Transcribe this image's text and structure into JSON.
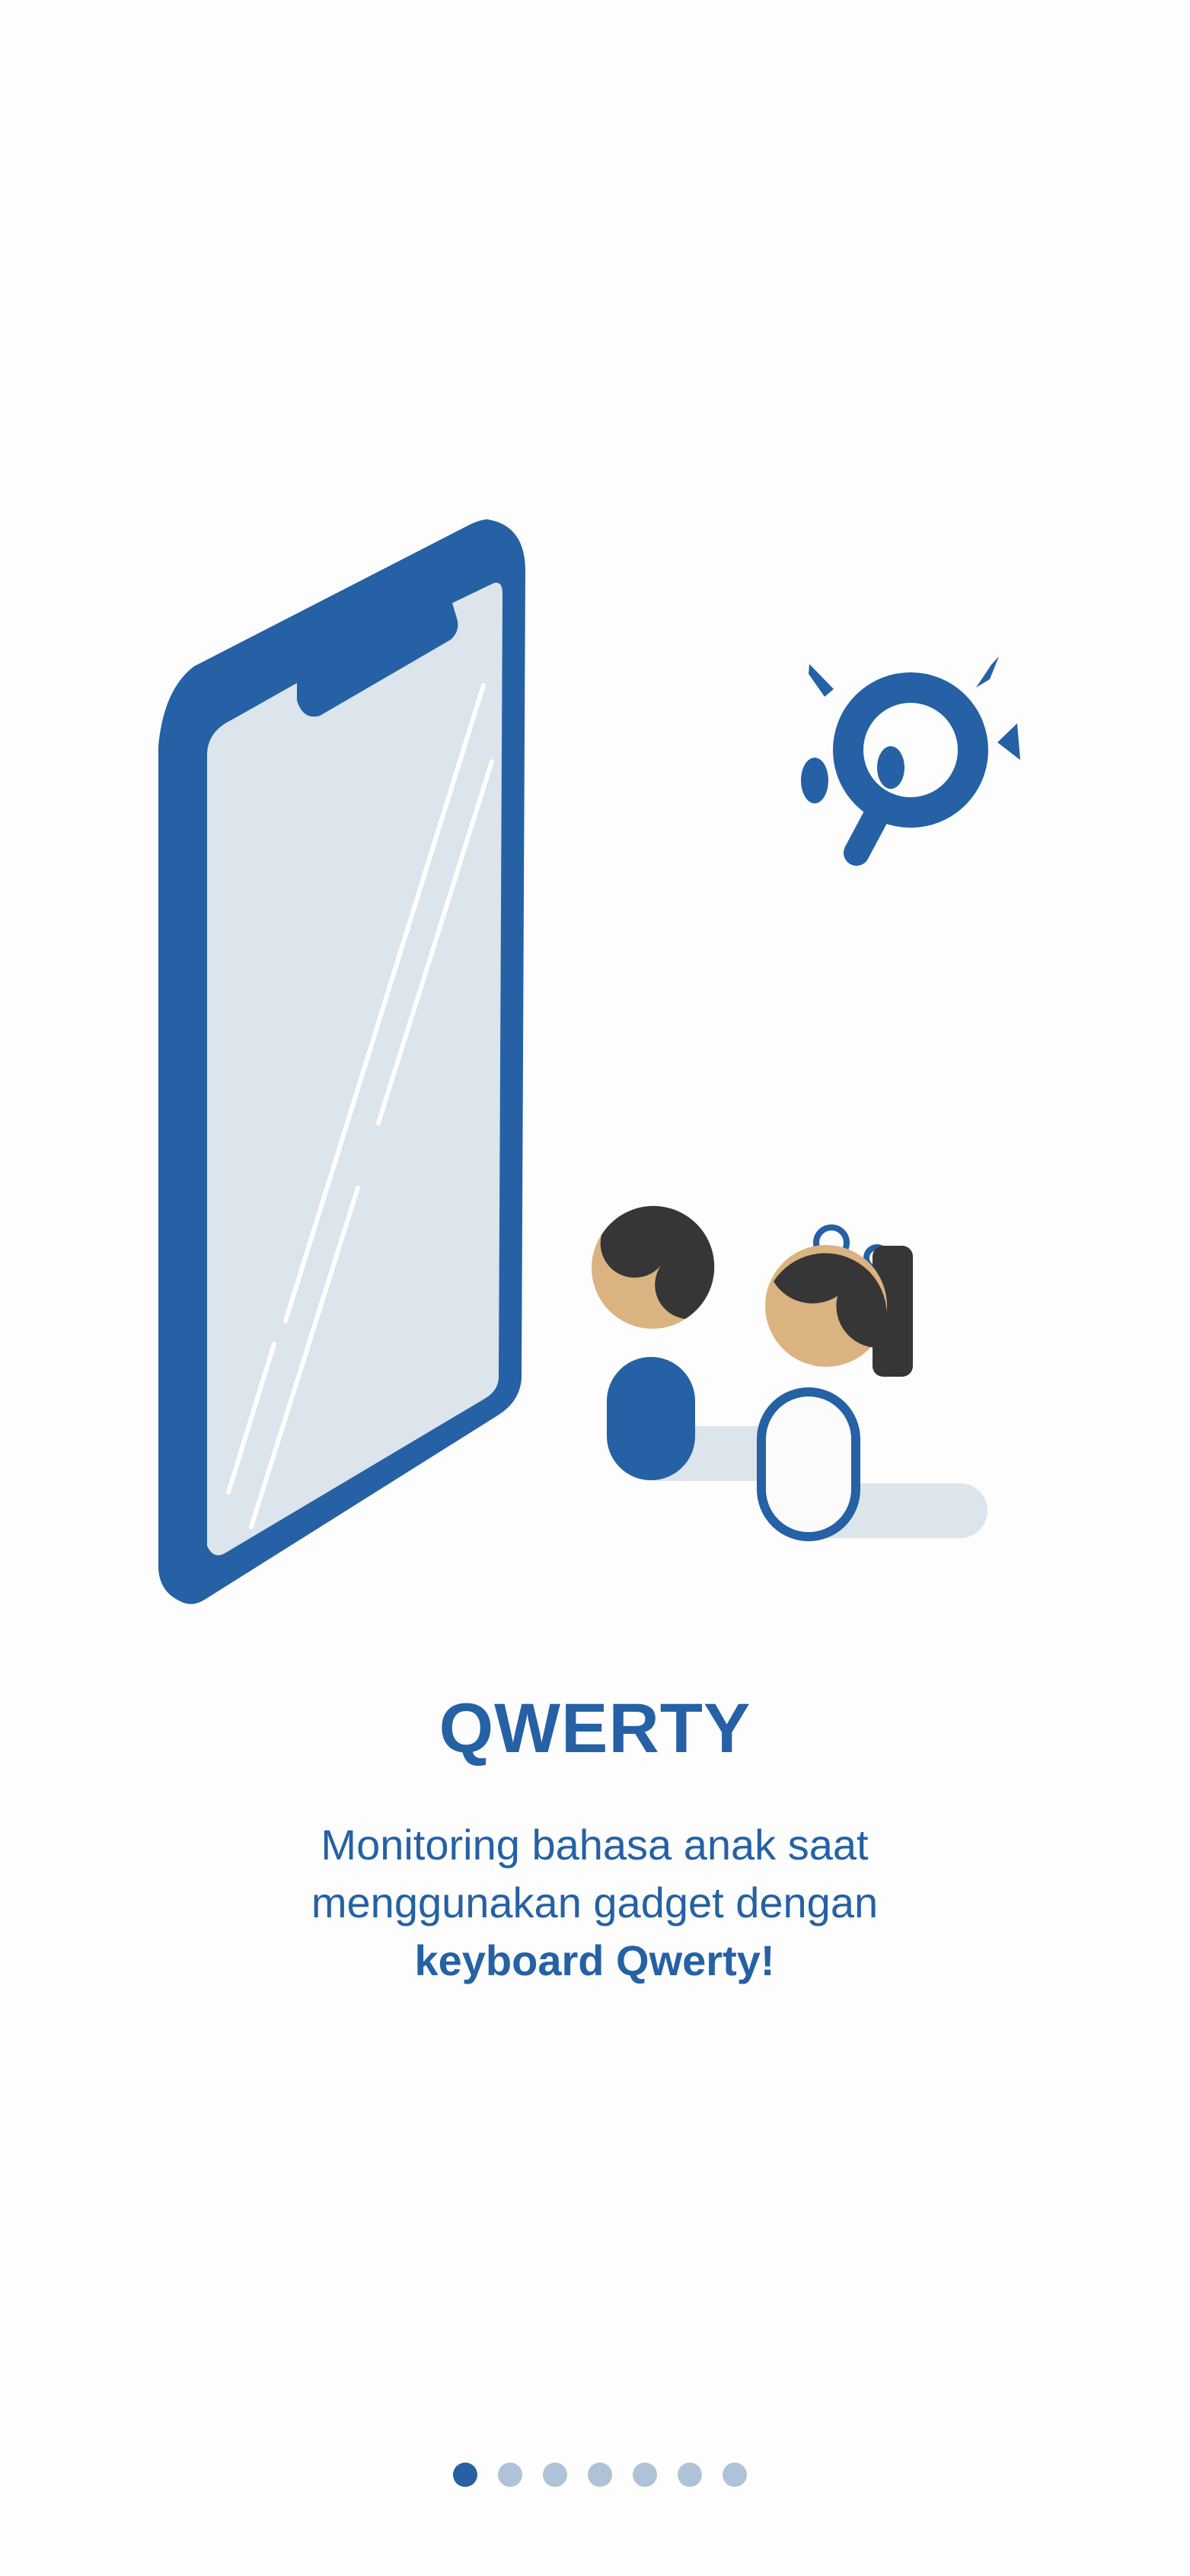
{
  "onboarding": {
    "title": "QWERTY",
    "description_line1": "Monitoring bahasa anak saat",
    "description_line2": "menggunakan gadget dengan",
    "description_line3": "keyboard Qwerty!"
  },
  "pager": {
    "total_pages": 7,
    "current_page": 1
  },
  "illustration": {
    "icons": [
      "smartphone-icon",
      "magnifier-icon",
      "child-boy-icon",
      "child-girl-icon"
    ]
  },
  "colors": {
    "primary": "#2561a4",
    "screen": "#dce4ec",
    "skin": "#dbb381",
    "hair": "#363636",
    "dot_inactive": "#aec3d8",
    "background": "#fdfdfd"
  }
}
